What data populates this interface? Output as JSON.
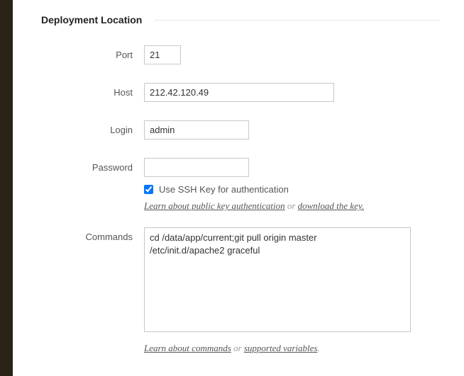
{
  "section": {
    "title": "Deployment Location"
  },
  "form": {
    "port": {
      "label": "Port",
      "value": "21"
    },
    "host": {
      "label": "Host",
      "value": "212.42.120.49"
    },
    "login": {
      "label": "Login",
      "value": "admin"
    },
    "password": {
      "label": "Password",
      "value": ""
    },
    "sshkey": {
      "label": "Use SSH Key for authentication",
      "checked": true
    },
    "commands": {
      "label": "Commands",
      "value": "cd /data/app/current;git pull origin master\n/etc/init.d/apache2 graceful"
    }
  },
  "help": {
    "pubkey": {
      "learn_text": "Learn about public key authentication",
      "or": " or ",
      "download_text": "download the key."
    },
    "commands": {
      "learn_text": "Learn about commands",
      "or": " or ",
      "vars_text": "supported variables",
      "period": "."
    }
  }
}
